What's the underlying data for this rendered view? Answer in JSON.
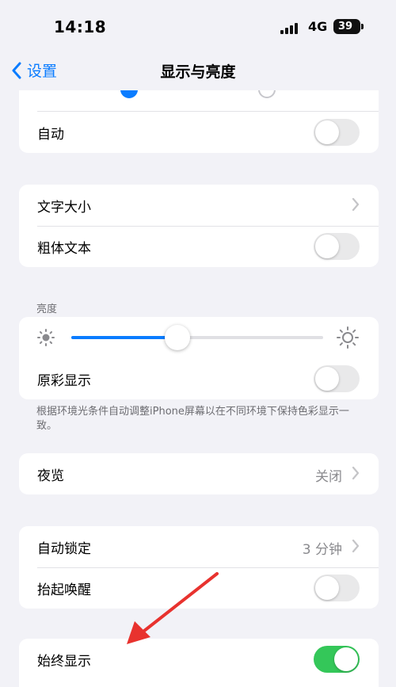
{
  "status_bar": {
    "time": "14:18",
    "network": "4G",
    "battery": "39"
  },
  "nav": {
    "back_label": "设置",
    "title": "显示与亮度"
  },
  "group_top": {
    "auto_label": "自动",
    "auto_on": false
  },
  "group_text": {
    "text_size_label": "文字大小",
    "bold_text_label": "粗体文本",
    "bold_text_on": false
  },
  "brightness": {
    "header": "亮度",
    "level": 0.42,
    "true_tone_label": "原彩显示",
    "true_tone_on": false,
    "footer": "根据环境光条件自动调整iPhone屏幕以在不同环境下保持色彩显示一致。"
  },
  "night_shift": {
    "label": "夜览",
    "value": "关闭"
  },
  "lock_group": {
    "auto_lock_label": "自动锁定",
    "auto_lock_value": "3 分钟",
    "raise_to_wake_label": "抬起唤醒",
    "raise_to_wake_on": false
  },
  "always_on": {
    "label": "始终显示",
    "on": true
  },
  "colors": {
    "accent": "#0a7cff",
    "toggle_on": "#34c759",
    "annotation_arrow": "#e8322e"
  }
}
